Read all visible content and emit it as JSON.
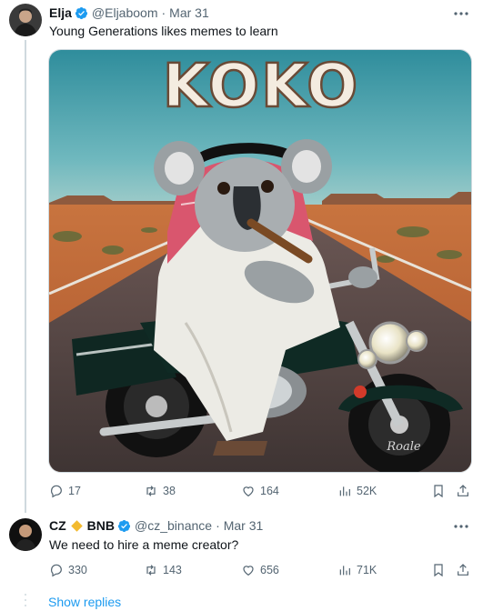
{
  "tweet1": {
    "name": "Elja",
    "handle": "@Eljaboom",
    "date": "Mar 31",
    "text": "Young Generations likes memes to learn",
    "image_title": "KOKO",
    "image_plate": "Roale",
    "actions": {
      "replies": "17",
      "reposts": "38",
      "likes": "164",
      "views": "52K"
    }
  },
  "tweet2": {
    "name": "CZ",
    "name_suffix": "BNB",
    "handle": "@cz_binance",
    "date": "Mar 31",
    "text": "We need to hire a meme creator?",
    "actions": {
      "replies": "330",
      "reposts": "143",
      "likes": "656",
      "views": "71K"
    }
  },
  "separator": "·",
  "show_replies": "Show replies",
  "colors": {
    "verified": "#1d9bf0",
    "link": "#1d9bf0",
    "muted": "#536471",
    "binance": "#f3ba2f"
  }
}
